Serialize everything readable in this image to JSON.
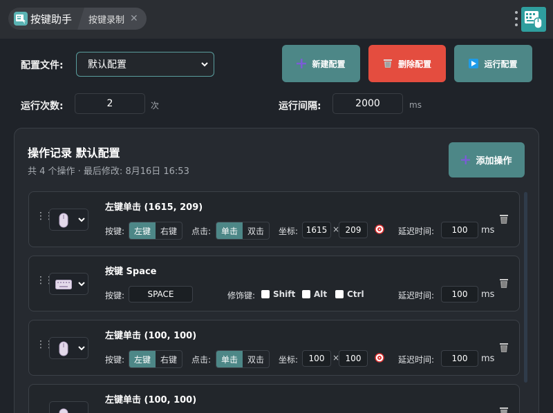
{
  "tabs": [
    {
      "label": "按键助手"
    },
    {
      "label": "按键录制",
      "close": "✕"
    }
  ],
  "config": {
    "file_label": "配置文件:",
    "selected": "默认配置",
    "run_count_label": "运行次数:",
    "run_count": "2",
    "run_count_unit": "次",
    "interval_label": "运行间隔:",
    "interval": "2000",
    "interval_unit": "ms"
  },
  "buttons": {
    "new": "新建配置",
    "delete": "删除配置",
    "run": "运行配置",
    "add": "添加操作"
  },
  "colors": {
    "teal": "#4d8787",
    "red": "#e44d3f",
    "bg": "#1f2329"
  },
  "panel": {
    "title": "操作记录 默认配置",
    "subtitle": "共 4 个操作 · 最后修改: 8月16日 16:53"
  },
  "labels": {
    "key": "按键:",
    "click": "点击:",
    "coords": "坐标:",
    "delay": "延迟时间:",
    "modifiers": "修饰键:",
    "left": "左键",
    "right": "右键",
    "single": "单击",
    "double": "双击",
    "x": "×",
    "ms": "ms",
    "shift": "Shift",
    "alt": "Alt",
    "ctrl": "Ctrl"
  },
  "ops": [
    {
      "type_icon": "mouse-icon",
      "title": "左键单击 (1615, 209)",
      "x": "1615",
      "y": "209",
      "delay": "100"
    },
    {
      "type_icon": "keyboard-icon",
      "title": "按键 Space",
      "key": "SPACE",
      "delay": "100"
    },
    {
      "type_icon": "mouse-icon",
      "title": "左键单击 (100, 100)",
      "x": "100",
      "y": "100",
      "delay": "100"
    },
    {
      "type_icon": "mouse-icon",
      "title": "左键单击 (100, 100)"
    }
  ]
}
